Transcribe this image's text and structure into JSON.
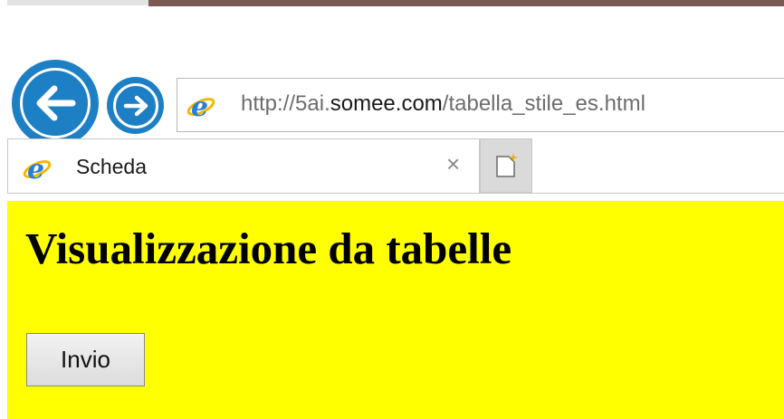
{
  "browser": {
    "address_url_prefix": "http://5ai.",
    "address_url_domain": "somee.com",
    "address_url_path": "/tabella_stile_es.html",
    "tab_title": "Scheda",
    "tab_close_glyph": "×",
    "icons": {
      "back": "back-arrow-icon",
      "forward": "forward-arrow-icon",
      "site": "internet-explorer-icon",
      "new_tab": "new-tab-icon"
    },
    "accent_color": "#1d7fc4"
  },
  "page": {
    "background_color": "#ffff00",
    "heading": "Visualizzazione da tabelle",
    "submit_label": "Invio"
  }
}
